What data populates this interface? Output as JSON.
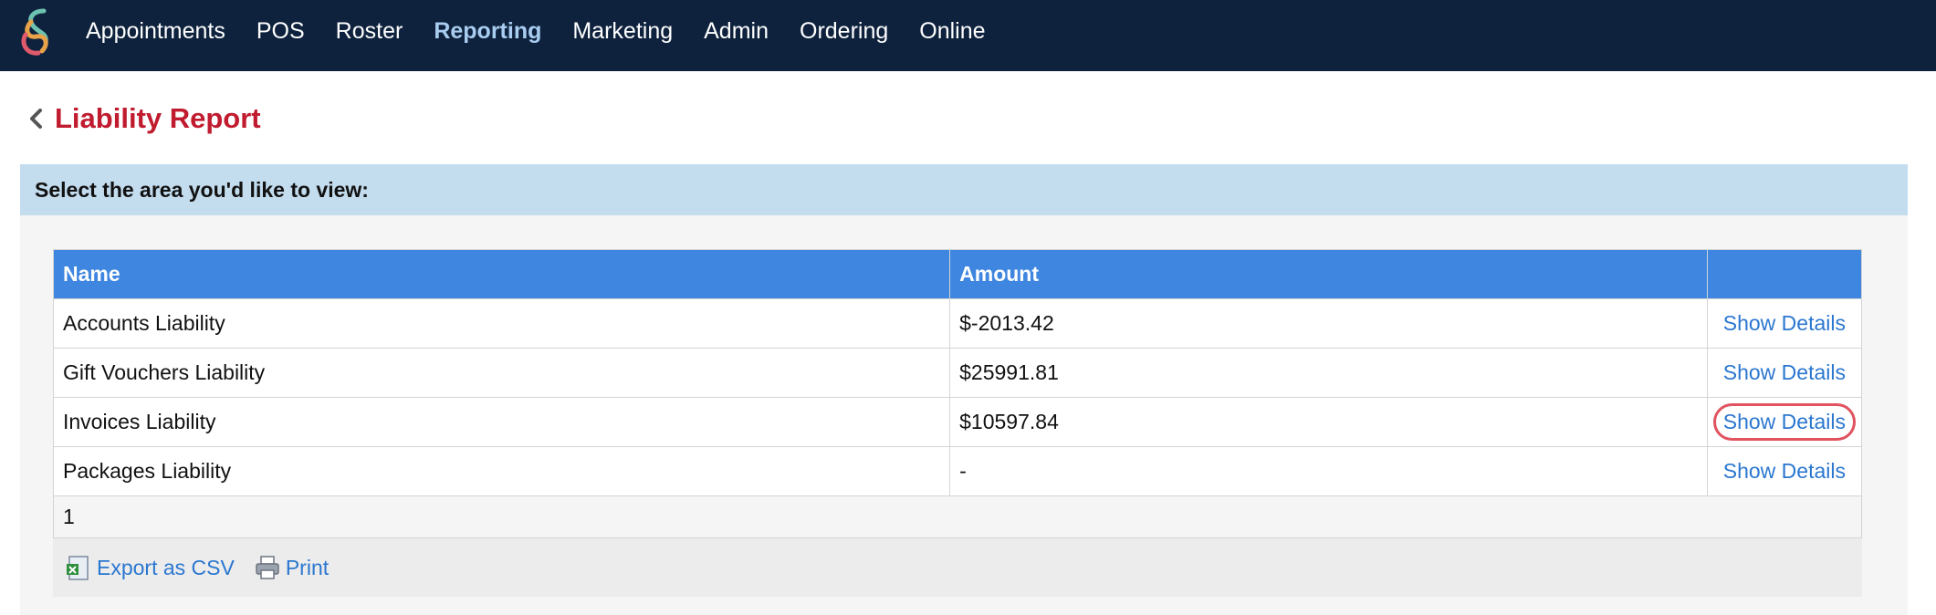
{
  "nav": {
    "items": [
      {
        "label": "Appointments",
        "active": false
      },
      {
        "label": "POS",
        "active": false
      },
      {
        "label": "Roster",
        "active": false
      },
      {
        "label": "Reporting",
        "active": true
      },
      {
        "label": "Marketing",
        "active": false
      },
      {
        "label": "Admin",
        "active": false
      },
      {
        "label": "Ordering",
        "active": false
      },
      {
        "label": "Online",
        "active": false
      }
    ]
  },
  "page": {
    "title": "Liability Report",
    "section_prompt": "Select the area you'd like to view:"
  },
  "table": {
    "headers": {
      "name": "Name",
      "amount": "Amount",
      "action": ""
    },
    "rows": [
      {
        "name": "Accounts Liability",
        "amount": "$-2013.42",
        "action": "Show Details"
      },
      {
        "name": "Gift Vouchers Liability",
        "amount": "$25991.81",
        "action": "Show Details"
      },
      {
        "name": "Invoices Liability",
        "amount": "$10597.84",
        "action": "Show Details",
        "highlighted": true
      },
      {
        "name": "Packages Liability",
        "amount": "-",
        "action": "Show Details"
      }
    ],
    "pager": "1"
  },
  "footer": {
    "export_label": "Export as CSV",
    "print_label": "Print"
  },
  "colors": {
    "topbar": "#0e223d",
    "active_nav": "#a9cdf0",
    "title": "#c01b2e",
    "table_header": "#3e86e0",
    "link": "#2b77d0",
    "highlight_ring": "#e0535f"
  }
}
